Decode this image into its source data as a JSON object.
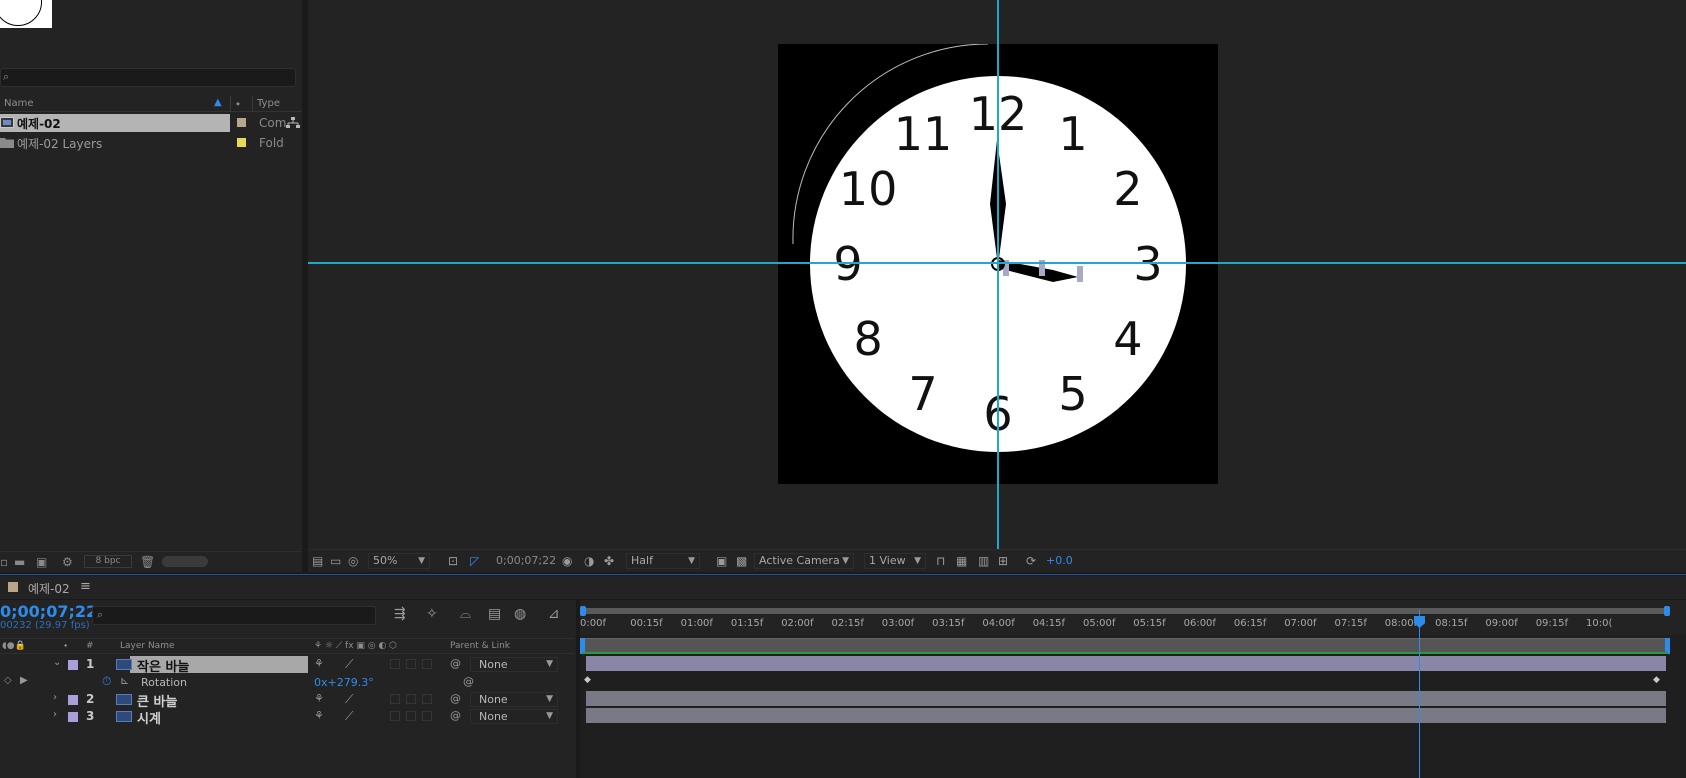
{
  "project": {
    "column_headers": {
      "name": "Name",
      "type": "Type"
    },
    "items": [
      {
        "name": "예제-02",
        "type": "Com",
        "label_color": "#b8a58a"
      },
      {
        "name": "예제-02 Layers",
        "type": "Fold",
        "label_color": "#e8d85a"
      }
    ],
    "bpc": "8 bpc"
  },
  "viewer": {
    "zoom": "50%",
    "timecode": "0;00;07;22",
    "resolution": "Half",
    "camera": "Active Camera",
    "view": "1 View",
    "exposure": "+0.0",
    "clock_numbers": [
      "12",
      "1",
      "2",
      "3",
      "4",
      "5",
      "6",
      "7",
      "8",
      "9",
      "10",
      "11"
    ]
  },
  "timeline": {
    "tab_name": "예제-02",
    "timecode": "0;00;07;22",
    "frames": "00232 (29.97 fps)",
    "column_headers": {
      "layer_name": "Layer Name",
      "parent": "Parent & Link"
    },
    "layers": [
      {
        "num": "1",
        "name": "작은 바늘",
        "parent": "None"
      },
      {
        "num": "2",
        "name": "큰 바늘",
        "parent": "None"
      },
      {
        "num": "3",
        "name": "시계",
        "parent": "None"
      }
    ],
    "property": {
      "name": "Rotation",
      "value": "0x+279.3°"
    },
    "ruler_ticks": [
      "0:00f",
      "00:15f",
      "01:00f",
      "01:15f",
      "02:00f",
      "02:15f",
      "03:00f",
      "03:15f",
      "04:00f",
      "04:15f",
      "05:00f",
      "05:15f",
      "06:00f",
      "06:15f",
      "07:00f",
      "07:15f",
      "08:00f",
      "08:15f",
      "09:00f",
      "09:15f",
      "10:0("
    ]
  },
  "colors": {
    "accent": "#2d8ceb",
    "guide": "#20a8c8",
    "layer_label": "#a8a0d8",
    "panel_bg": "#232323"
  }
}
